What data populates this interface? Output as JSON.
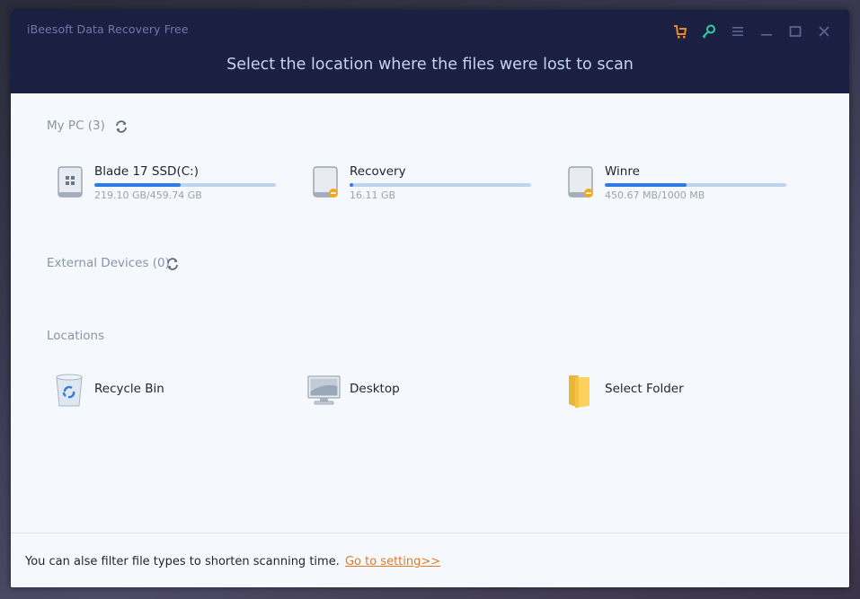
{
  "app": {
    "title": "iBeesoft Data Recovery Free",
    "headline": "Select the location where the files were lost to scan"
  },
  "window_controls": [
    {
      "name": "cart-icon",
      "color": "#f08a24"
    },
    {
      "name": "key-icon",
      "color": "#2fd0a4"
    },
    {
      "name": "menu-icon",
      "color": "#5a6690"
    },
    {
      "name": "minimize-icon",
      "color": "#5a6690"
    },
    {
      "name": "maximize-icon",
      "color": "#5a6690"
    },
    {
      "name": "close-icon",
      "color": "#5a6690"
    }
  ],
  "my_pc": {
    "label": "My PC (3)",
    "drives": [
      {
        "name": "Blade 17 SSD(C:)",
        "size": "219.10 GB/459.74 GB",
        "used_fraction": 0.4766,
        "type": "system"
      },
      {
        "name": "Recovery",
        "size": "16.11 GB",
        "used_fraction": 0.02,
        "type": "partition"
      },
      {
        "name": "Winre",
        "size": "450.67 MB/1000 MB",
        "used_fraction": 0.4507,
        "type": "partition"
      }
    ]
  },
  "external_devices": {
    "label": "External Devices (0)"
  },
  "locations": {
    "label": "Locations",
    "items": [
      {
        "name": "Recycle Bin",
        "icon": "recycle-bin-icon"
      },
      {
        "name": "Desktop",
        "icon": "desktop-icon"
      },
      {
        "name": "Select Folder",
        "icon": "folder-icon"
      }
    ]
  },
  "footer": {
    "text": "You can alse filter file types to shorten scanning time.",
    "link": "Go to setting>>"
  },
  "colors": {
    "header_bg": "#1b1f42",
    "accent_blue": "#2f7ae5",
    "link_orange": "#e07a2a",
    "key_green": "#2fd0a4"
  }
}
